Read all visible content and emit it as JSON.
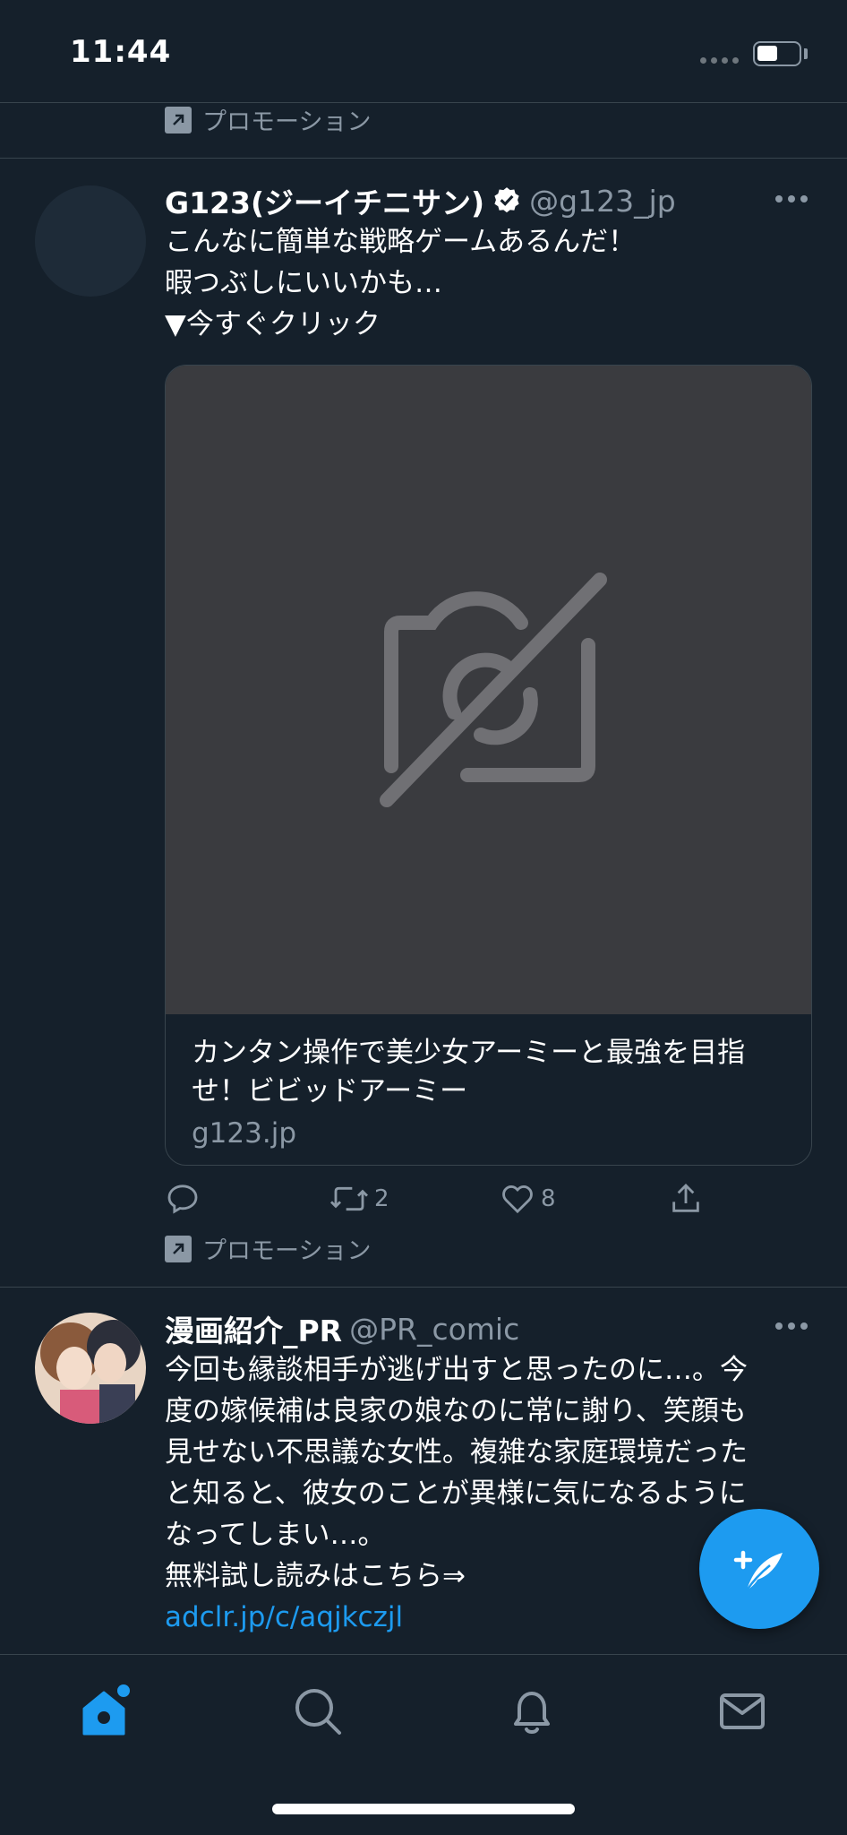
{
  "status_bar": {
    "time": "11:44"
  },
  "promotion_label": "プロモーション",
  "tweets": [
    {
      "name": "G123(ジーイチニサン)",
      "handle": "@g123_jp",
      "verified": true,
      "text_lines": [
        "こんなに簡単な戦略ゲームあるんだ！",
        "暇つぶしにいいかも…",
        "▼今すぐクリック"
      ],
      "card": {
        "media_icon": "image-unavailable-icon",
        "title": "カンタン操作で美少女アーミーと最強を目指せ！ビビッドアーミー",
        "domain": "g123.jp"
      },
      "actions": {
        "reply_count": "",
        "retweet_count": "2",
        "like_count": "8"
      }
    },
    {
      "name": "漫画紹介_PR",
      "handle": "@PR_comic",
      "text_lines": [
        "今回も縁談相手が逃げ出すと思ったのに…。今",
        "度の嫁候補は良家の娘なのに常に謝り、笑顔も",
        "見せない不思議な女性。複雑な家庭環境だった",
        "と知ると、彼女のことが異様に気になるように",
        "なってしまい…。",
        "無料試し読みはこちら⇒"
      ],
      "link": "adclr.jp/c/aqjkczjl"
    }
  ],
  "tab_bar": {
    "items": [
      "home-icon",
      "search-icon",
      "bell-icon",
      "mail-icon"
    ],
    "active": "home-icon"
  },
  "colors": {
    "background": "#15202b",
    "accent": "#1d9bf0",
    "secondary_text": "#8b98a5",
    "divider": "#38444d"
  }
}
